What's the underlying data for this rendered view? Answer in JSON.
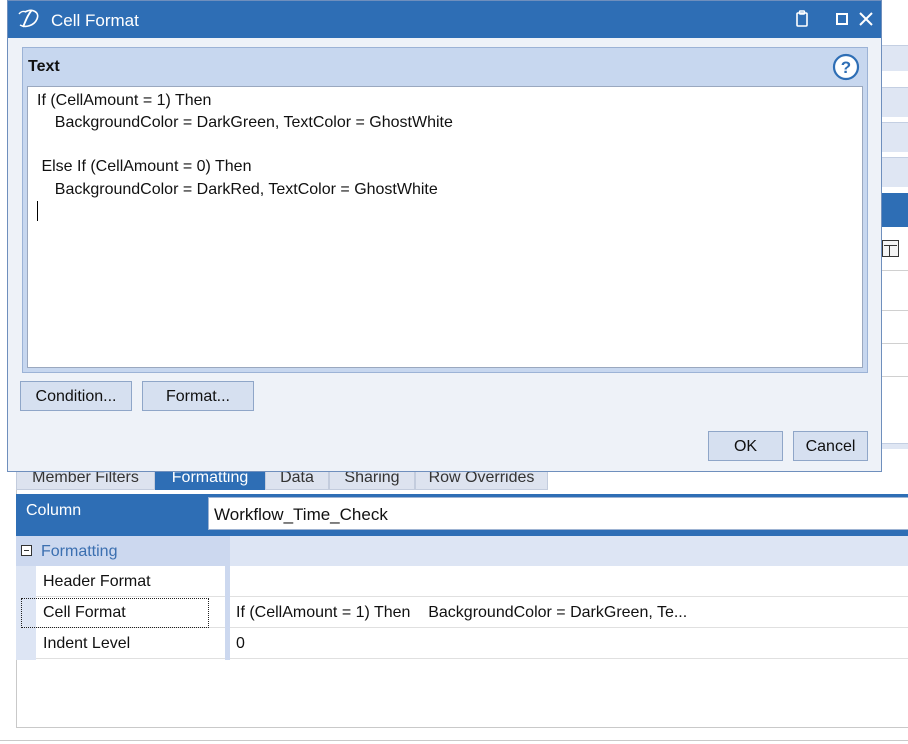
{
  "dialog": {
    "title": "Cell Format",
    "group_label": "Text",
    "text_lines": [
      "If (CellAmount = 1) Then",
      "    BackgroundColor = DarkGreen, TextColor = GhostWhite",
      "",
      " Else If (CellAmount = 0) Then",
      "    BackgroundColor = DarkRed, TextColor = GhostWhite"
    ],
    "condition_button": "Condition...",
    "format_button": "Format...",
    "ok_button": "OK",
    "cancel_button": "Cancel",
    "help_symbol": "?"
  },
  "tabs": [
    "Member Filters",
    "Formatting",
    "Data",
    "Sharing",
    "Row Overrides"
  ],
  "active_tab": "Formatting",
  "column": {
    "label": "Column",
    "value": "Workflow_Time_Check"
  },
  "property_grid": {
    "category": "Formatting",
    "rows": [
      {
        "name": "Header Format",
        "value": ""
      },
      {
        "name": "Cell Format",
        "value": "If (CellAmount = 1) Then    BackgroundColor = DarkGreen, Te..."
      },
      {
        "name": "Indent Level",
        "value": "0"
      }
    ]
  },
  "colors": {
    "accent": "#2e6eb5",
    "dialog_bg": "#eef2f8",
    "group_bg": "#c7d7ef"
  }
}
